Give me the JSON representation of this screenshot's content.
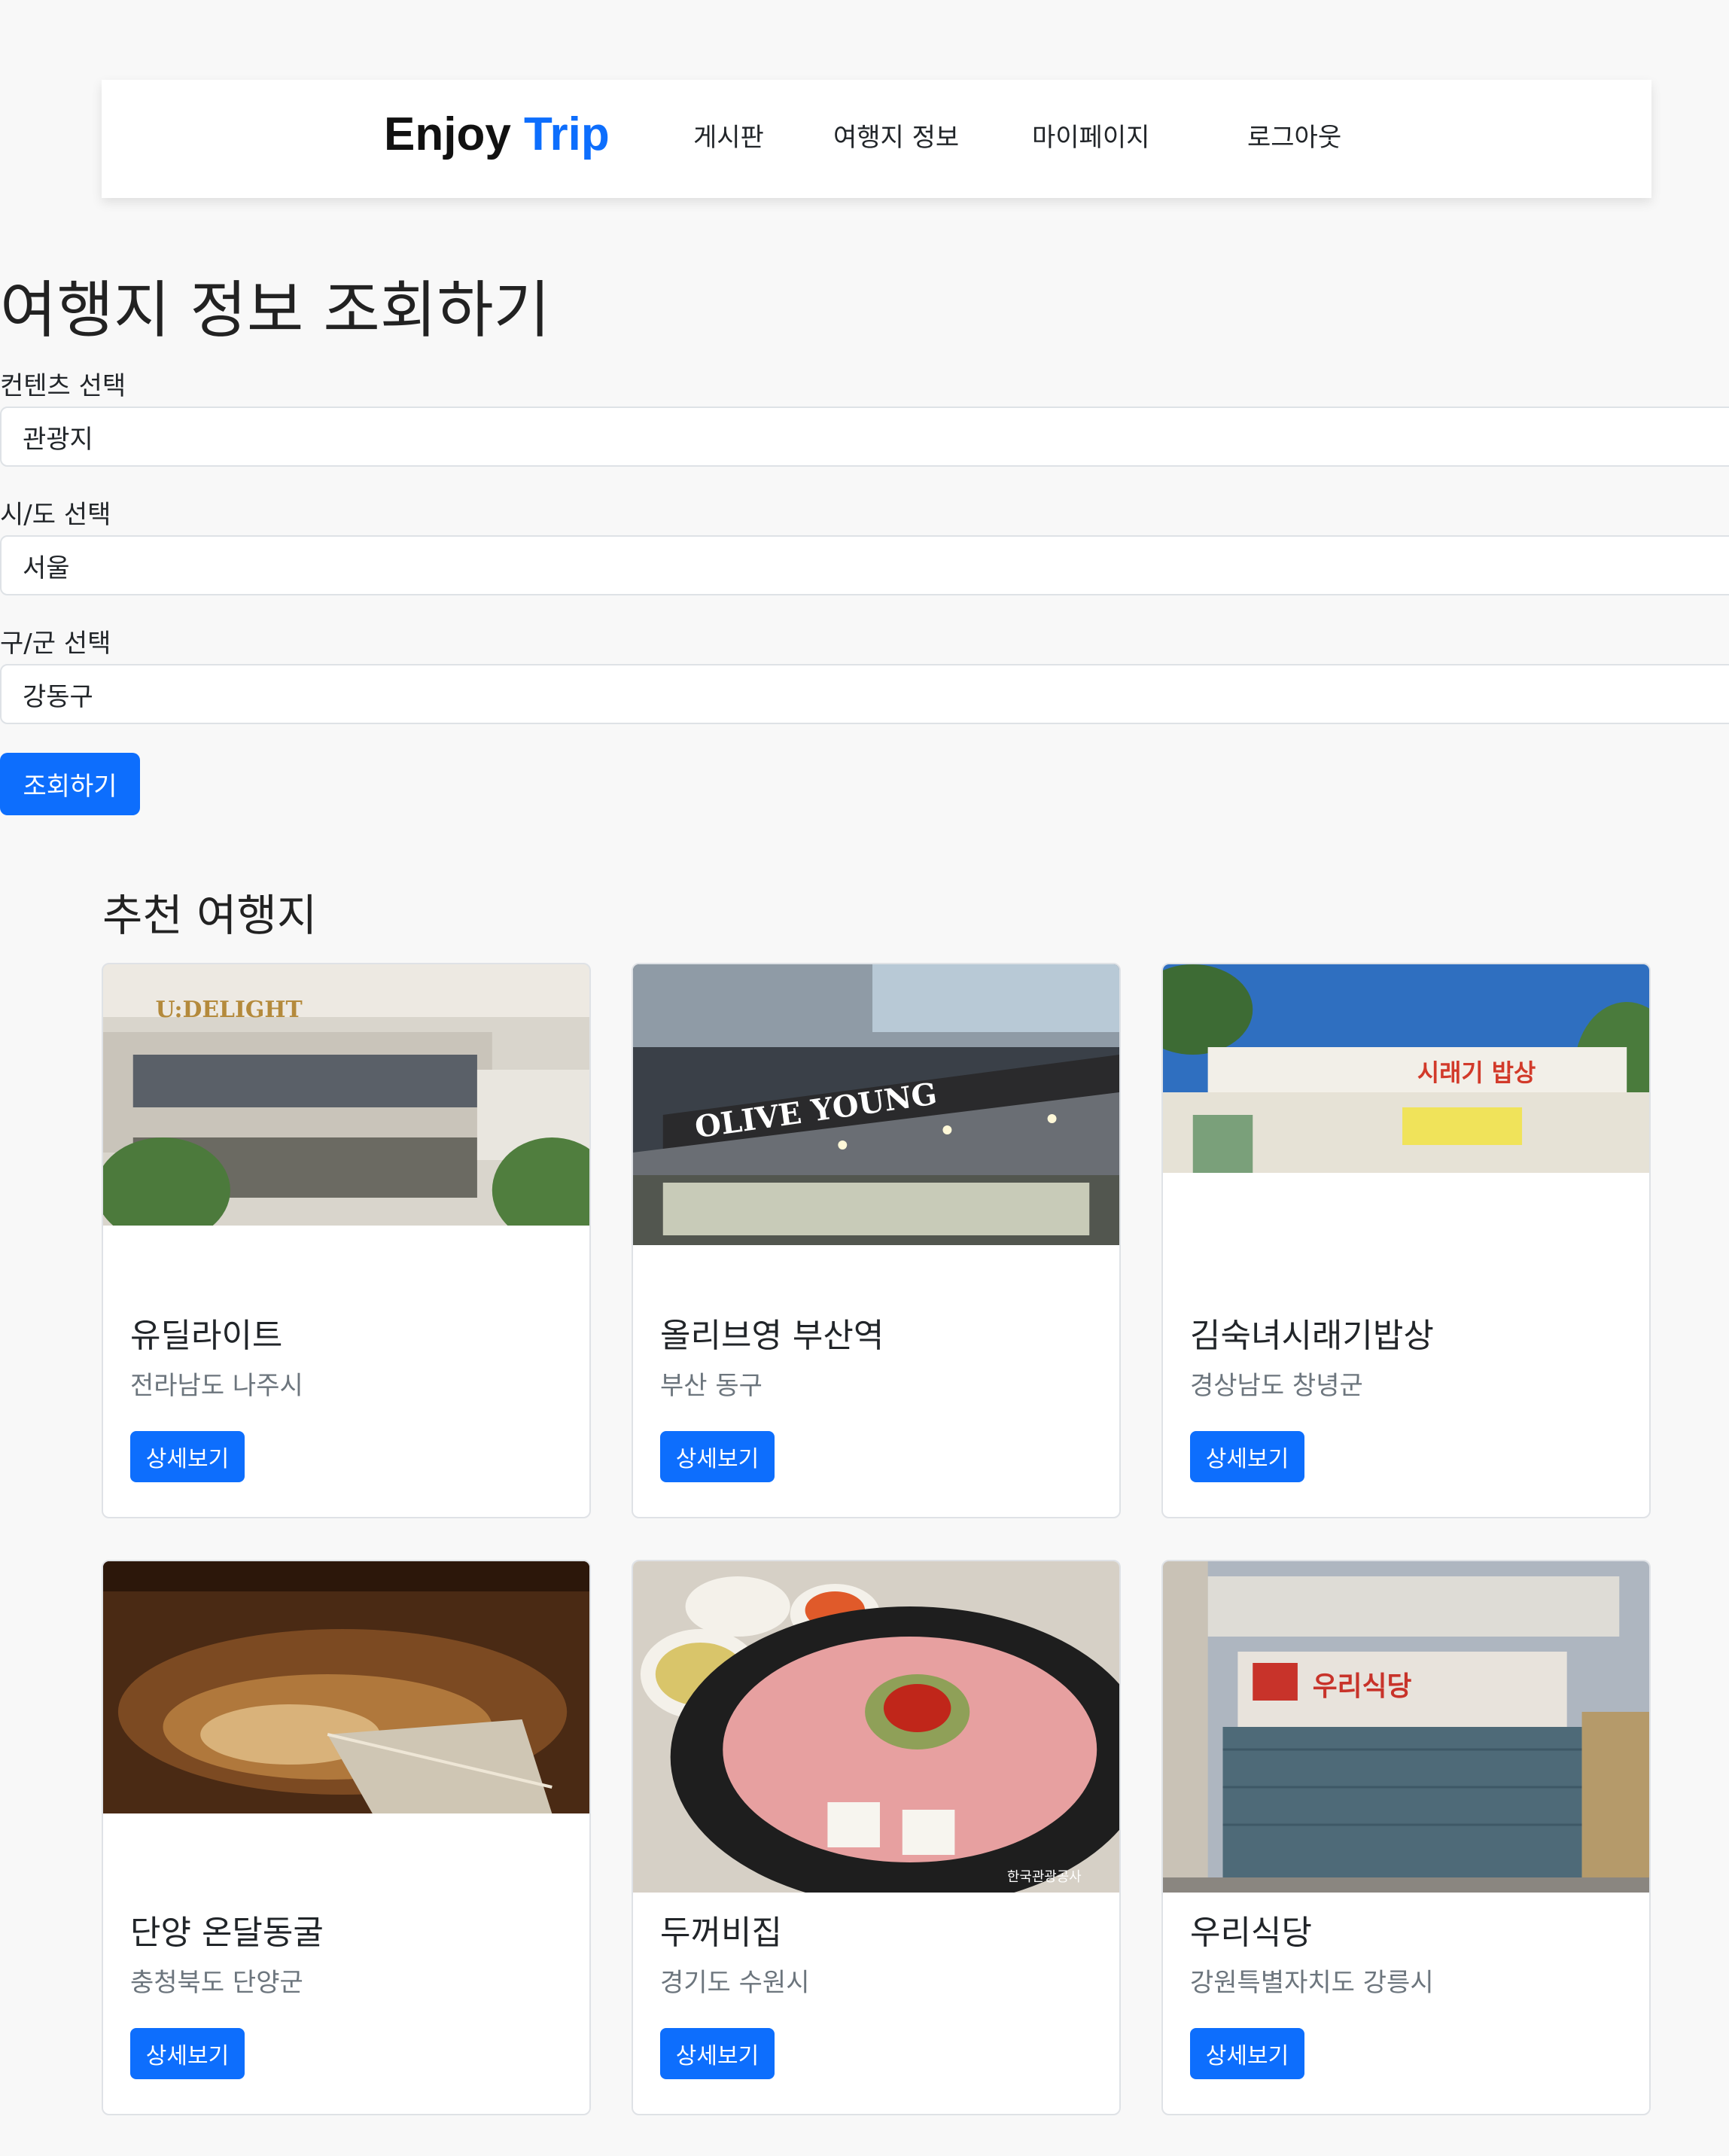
{
  "nav": {
    "brand_first": "Enjoy",
    "brand_second": "Trip",
    "links": [
      "게시판",
      "여행지 정보",
      "마이페이지",
      "로그아웃"
    ]
  },
  "search": {
    "title": "여행지 정보 조회하기",
    "content_label": "컨텐츠 선택",
    "content_value": "관광지",
    "sido_label": "시/도 선택",
    "sido_value": "서울",
    "gugun_label": "구/군 선택",
    "gugun_value": "강동구",
    "button_label": "조회하기"
  },
  "recommended": {
    "title": "추천 여행지",
    "cards": [
      {
        "name": "유딜라이트",
        "region": "전라남도 나주시",
        "button": "상세보기",
        "sign": "U:DELIGHT"
      },
      {
        "name": "올리브영 부산역",
        "region": "부산 동구",
        "button": "상세보기",
        "sign": "OLIVE YOUNG"
      },
      {
        "name": "김숙녀시래기밥상",
        "region": "경상남도 창녕군",
        "button": "상세보기",
        "sign": "시래기 밥상"
      },
      {
        "name": "단양 온달동굴",
        "region": "충청북도 단양군",
        "button": "상세보기",
        "sign": ""
      },
      {
        "name": "두꺼비집",
        "region": "경기도 수원시",
        "button": "상세보기",
        "sign": "한국관광공사"
      },
      {
        "name": "우리식당",
        "region": "강원특별자치도 강릉시",
        "button": "상세보기",
        "sign": "우리식당"
      }
    ]
  },
  "colors": {
    "primary": "#0d6efd",
    "background": "#f8f8f8"
  }
}
